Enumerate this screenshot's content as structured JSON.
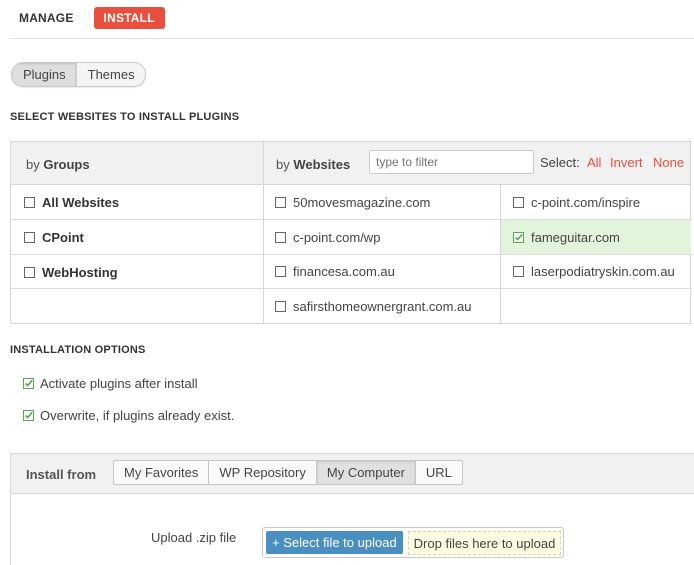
{
  "top_tabs": {
    "manage": "MANAGE",
    "install": "INSTALL"
  },
  "type_toggle": {
    "plugins": "Plugins",
    "themes": "Themes",
    "selected": "Plugins"
  },
  "select_section_title": "SELECT WEBSITES TO INSTALL PLUGINS",
  "selector": {
    "by_groups_prefix": "by ",
    "by_groups_bold": "Groups",
    "by_websites_prefix": "by ",
    "by_websites_bold": "Websites",
    "filter_placeholder": "type to filter",
    "select_label": "Select:",
    "select_all": "All",
    "select_invert": "Invert",
    "select_none": "None",
    "groups": [
      {
        "label": "All Websites",
        "checked": false
      },
      {
        "label": "CPoint",
        "checked": false
      },
      {
        "label": "WebHosting",
        "checked": false
      }
    ],
    "websites": [
      {
        "label": "50movesmagazine.com",
        "checked": false
      },
      {
        "label": "c-point.com/inspire",
        "checked": false
      },
      {
        "label": "c-point.com/wp",
        "checked": false
      },
      {
        "label": "fameguitar.com",
        "checked": true
      },
      {
        "label": "financesa.com.au",
        "checked": false
      },
      {
        "label": "laserpodiatryskin.com.au",
        "checked": false
      },
      {
        "label": "safirsthomeownergrant.com.au",
        "checked": false
      }
    ]
  },
  "options_section_title": "INSTALLATION OPTIONS",
  "options": [
    {
      "label": "Activate plugins after install",
      "checked": true
    },
    {
      "label": "Overwrite, if plugins already exist.",
      "checked": true
    }
  ],
  "install_from": {
    "label": "Install from",
    "tabs": [
      "My Favorites",
      "WP Repository",
      "My Computer",
      "URL"
    ],
    "selected": "My Computer",
    "upload_label": "Upload .zip file",
    "select_button": "+ Select file to upload",
    "drop_text": "Drop files here to upload"
  },
  "colors": {
    "accent": "#e8503d",
    "check_green": "#5aa64e",
    "upload_button": "#4a8fc2",
    "selected_row": "#e2f5dc"
  }
}
